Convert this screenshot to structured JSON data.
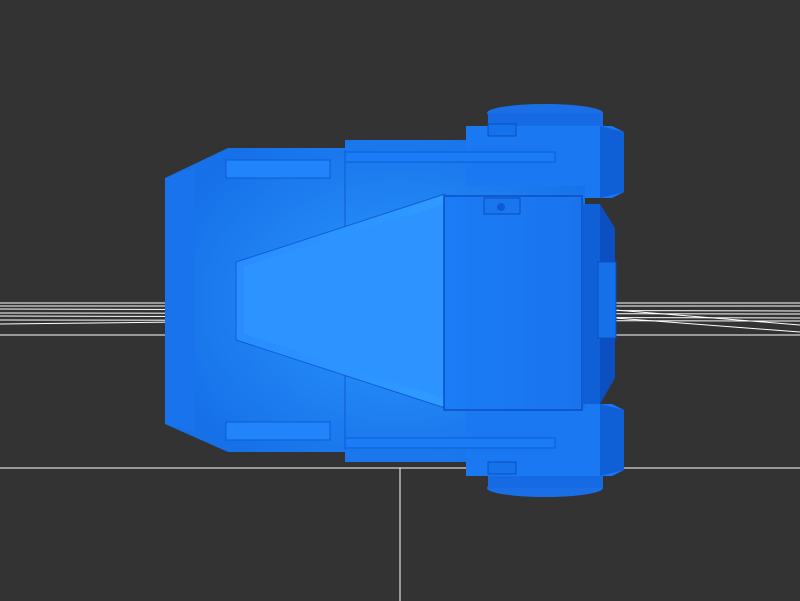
{
  "viewer": {
    "background_color": "#333333",
    "grid_color": "#ffffff",
    "model_color": "#1f7fff",
    "model_shadow_color": "#0a4fcf",
    "model_highlight_color": "#3b9bff",
    "view": "top",
    "object": "blue-3d-model"
  }
}
